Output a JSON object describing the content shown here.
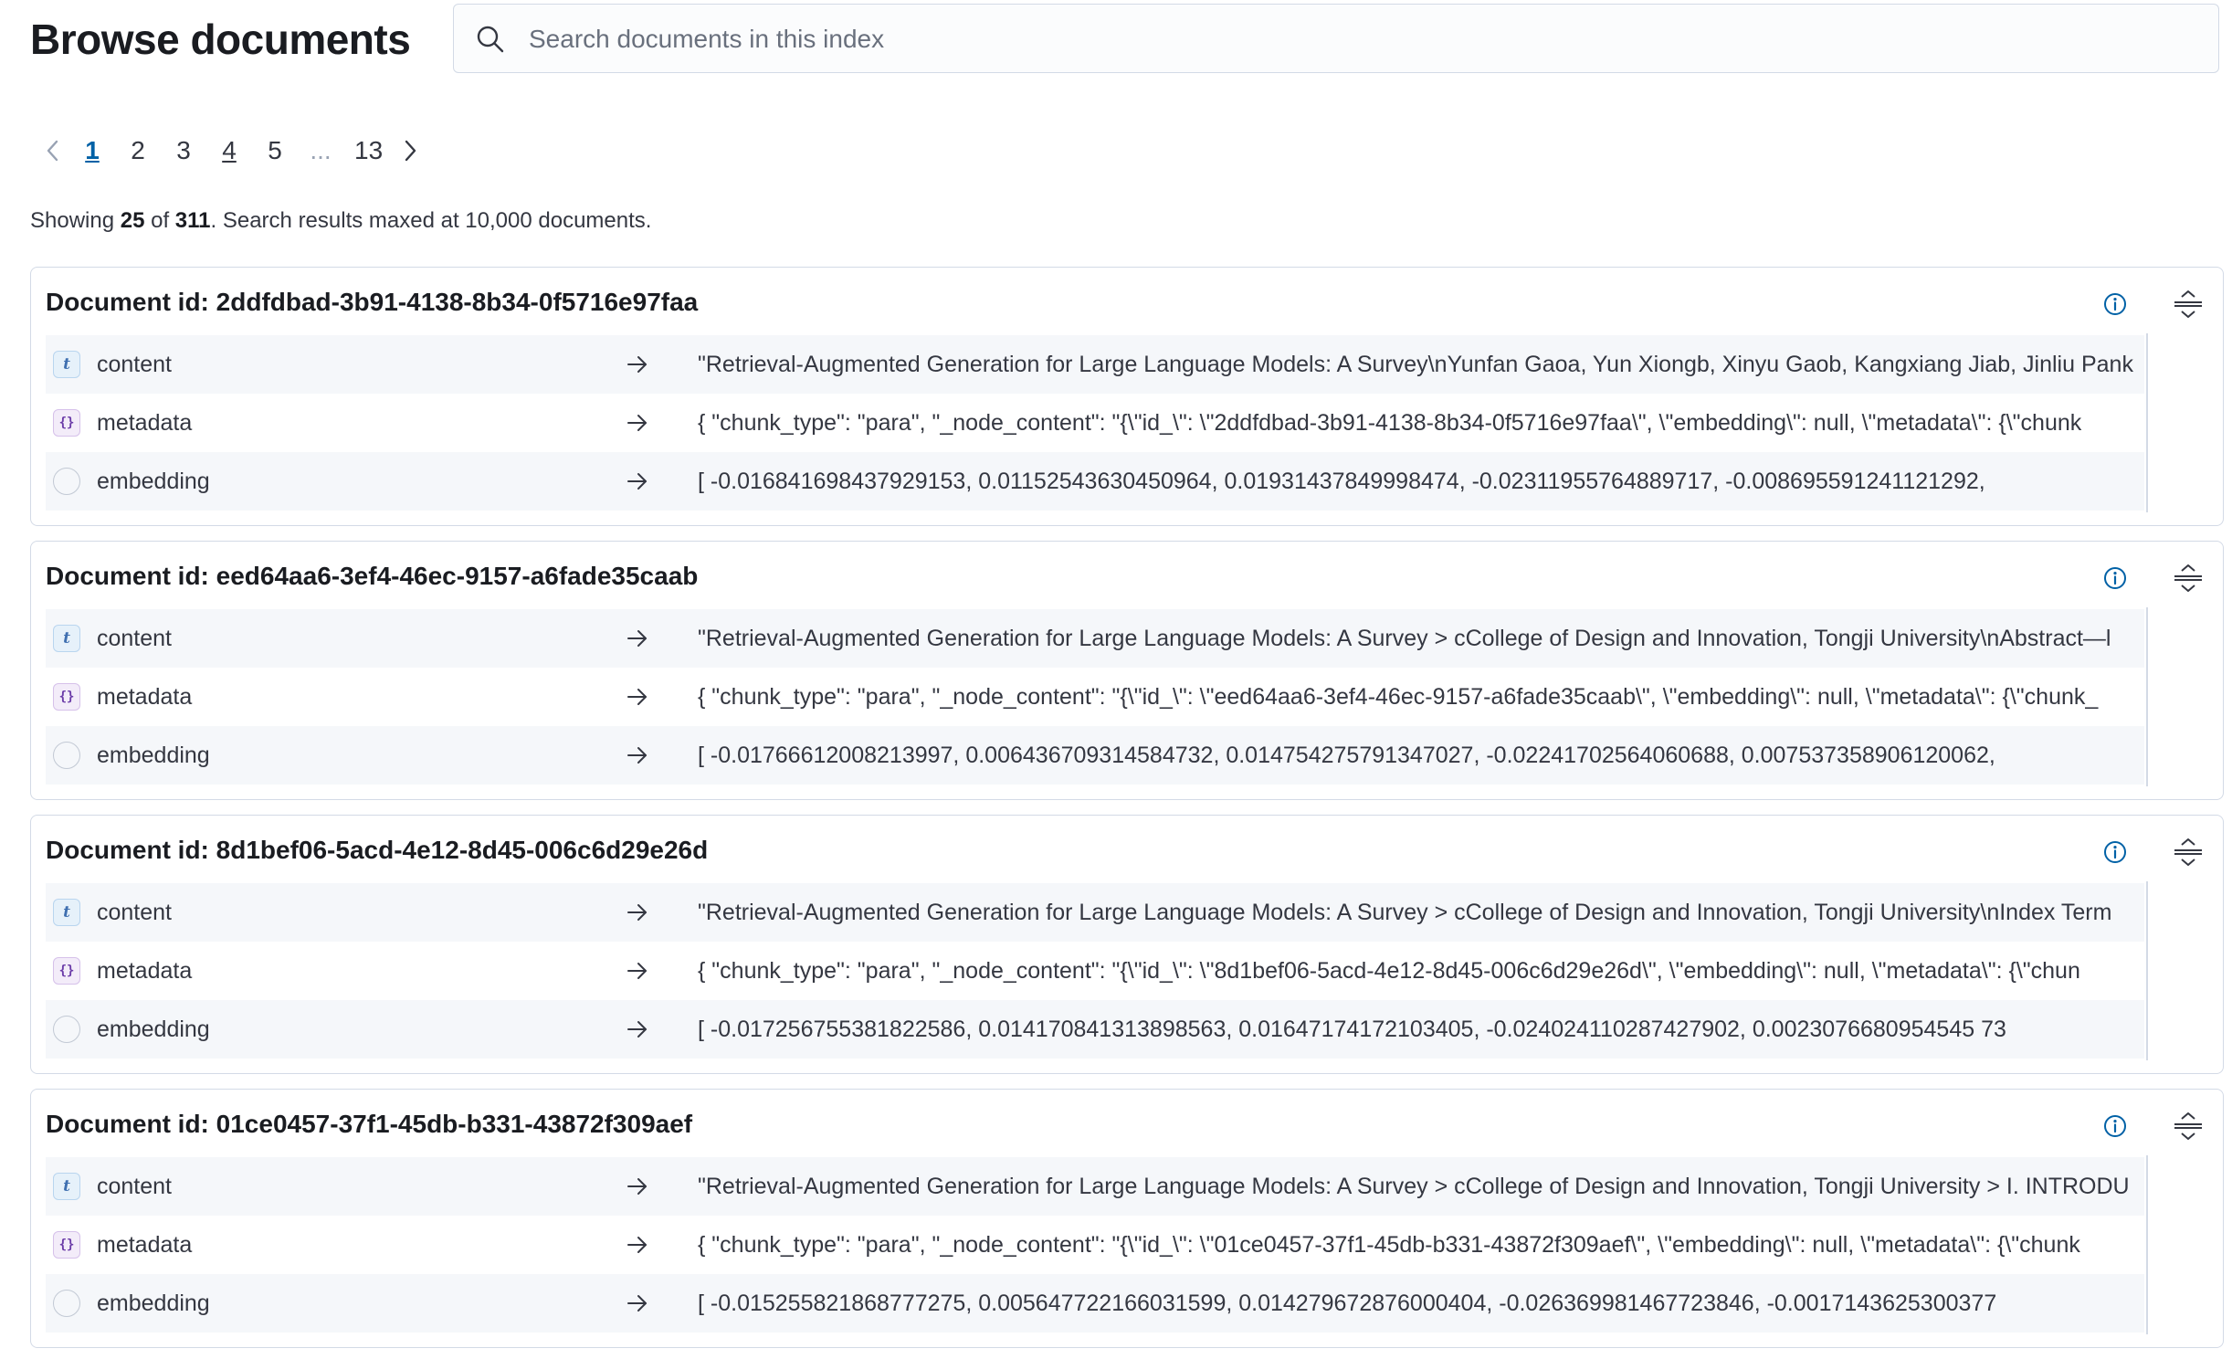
{
  "header": {
    "title": "Browse documents",
    "search_placeholder": "Search documents in this index"
  },
  "pagination": {
    "pages": [
      "1",
      "2",
      "3",
      "4",
      "5"
    ],
    "ellipsis": "...",
    "last_page": "13",
    "current": "1"
  },
  "summary": {
    "prefix": "Showing ",
    "shown": "25",
    "of": " of ",
    "total": "311",
    "suffix": ". Search results maxed at 10,000 documents."
  },
  "documents": [
    {
      "title": "Document id: 2ddfdbad-3b91-4138-8b34-0f5716e97faa",
      "fields": [
        {
          "name": "content",
          "type": "text",
          "value": "\"Retrieval-Augmented Generation for Large Language Models: A Survey\\nYunfan Gaoa, Yun Xiongb, Xinyu Gaob, Kangxiang Jiab, Jinliu Pank"
        },
        {
          "name": "metadata",
          "type": "object",
          "value": "{ \"chunk_type\": \"para\", \"_node_content\": \"{\\\"id_\\\": \\\"2ddfdbad-3b91-4138-8b34-0f5716e97faa\\\", \\\"embedding\\\": null, \\\"metadata\\\": {\\\"chunk"
        },
        {
          "name": "embedding",
          "type": "vector",
          "value": "[ -0.016841698437929153, 0.01152543630450964, 0.01931437849998474, -0.02311955764889717, -0.008695591241121292,"
        }
      ]
    },
    {
      "title": "Document id: eed64aa6-3ef4-46ec-9157-a6fade35caab",
      "fields": [
        {
          "name": "content",
          "type": "text",
          "value": "\"Retrieval-Augmented Generation for Large Language Models: A Survey > cCollege of Design and Innovation, Tongji University\\nAbstract—l"
        },
        {
          "name": "metadata",
          "type": "object",
          "value": "{ \"chunk_type\": \"para\", \"_node_content\": \"{\\\"id_\\\": \\\"eed64aa6-3ef4-46ec-9157-a6fade35caab\\\", \\\"embedding\\\": null, \\\"metadata\\\": {\\\"chunk_"
        },
        {
          "name": "embedding",
          "type": "vector",
          "value": "[ -0.01766612008213997, 0.006436709314584732, 0.014754275791347027, -0.02241702564060688, 0.007537358906120062,"
        }
      ]
    },
    {
      "title": "Document id: 8d1bef06-5acd-4e12-8d45-006c6d29e26d",
      "fields": [
        {
          "name": "content",
          "type": "text",
          "value": "\"Retrieval-Augmented Generation for Large Language Models: A Survey > cCollege of Design and Innovation, Tongji University\\nIndex Term"
        },
        {
          "name": "metadata",
          "type": "object",
          "value": "{ \"chunk_type\": \"para\", \"_node_content\": \"{\\\"id_\\\": \\\"8d1bef06-5acd-4e12-8d45-006c6d29e26d\\\", \\\"embedding\\\": null, \\\"metadata\\\": {\\\"chun"
        },
        {
          "name": "embedding",
          "type": "vector",
          "value": "[ -0.017256755381822586, 0.014170841313898563, 0.01647174172103405, -0.024024110287427902, 0.0023076680954545 73"
        }
      ]
    },
    {
      "title": "Document id: 01ce0457-37f1-45db-b331-43872f309aef",
      "fields": [
        {
          "name": "content",
          "type": "text",
          "value": "\"Retrieval-Augmented Generation for Large Language Models: A Survey > cCollege of Design and Innovation, Tongji University > I. INTRODU"
        },
        {
          "name": "metadata",
          "type": "object",
          "value": "{ \"chunk_type\": \"para\", \"_node_content\": \"{\\\"id_\\\": \\\"01ce0457-37f1-45db-b331-43872f309aef\\\", \\\"embedding\\\": null, \\\"metadata\\\": {\\\"chunk"
        },
        {
          "name": "embedding",
          "type": "vector",
          "value": "[ -0.015255821868777275, 0.005647722166031599, 0.014279672876000404, -0.026369981467723846, -0.0017143625300377"
        }
      ]
    }
  ],
  "colors": {
    "accent": "#0061a6",
    "border": "#d3dae6",
    "stripe": "#f5f7fa",
    "text": "#343741"
  }
}
